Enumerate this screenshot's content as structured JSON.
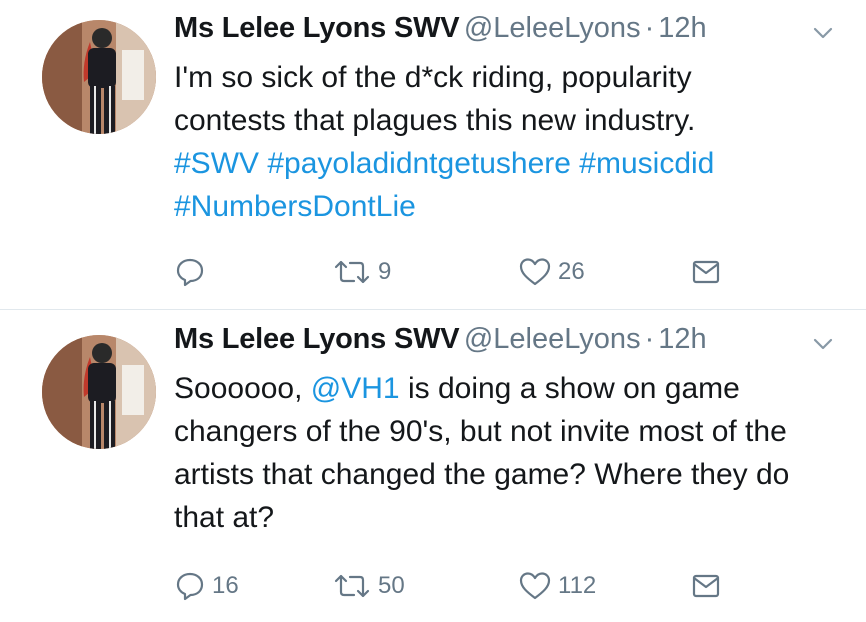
{
  "tweets": [
    {
      "author_name": "Ms Lelee Lyons SWV",
      "handle": "@LeleeLyons",
      "separator": "·",
      "time": "12h",
      "text_lines": [
        "I'm so sick of the d*ck riding, popularity",
        "contests that plagues this new industry."
      ],
      "hashtags": [
        "#SWV",
        "#payoladidntgetushere",
        "#musicdid",
        "#NumbersDontLie"
      ],
      "reply_count": "",
      "retweet_count": "9",
      "like_count": "26"
    },
    {
      "author_name": "Ms Lelee Lyons SWV",
      "handle": "@LeleeLyons",
      "separator": "·",
      "time": "12h",
      "text_start": "Soooooo, ",
      "mention": "@VH1",
      "text_rest": " is doing a show on game changers of the 90's, but not invite most of the artists that changed the game? Where they do that at?",
      "reply_count": "16",
      "retweet_count": "50",
      "like_count": "112"
    }
  ],
  "colors": {
    "text": "#14171a",
    "secondary": "#657786",
    "link": "#1b95e0",
    "divider": "#e1e8ed"
  },
  "icons": [
    "reply-icon",
    "retweet-icon",
    "like-icon",
    "direct-message-icon",
    "chevron-down-icon"
  ]
}
